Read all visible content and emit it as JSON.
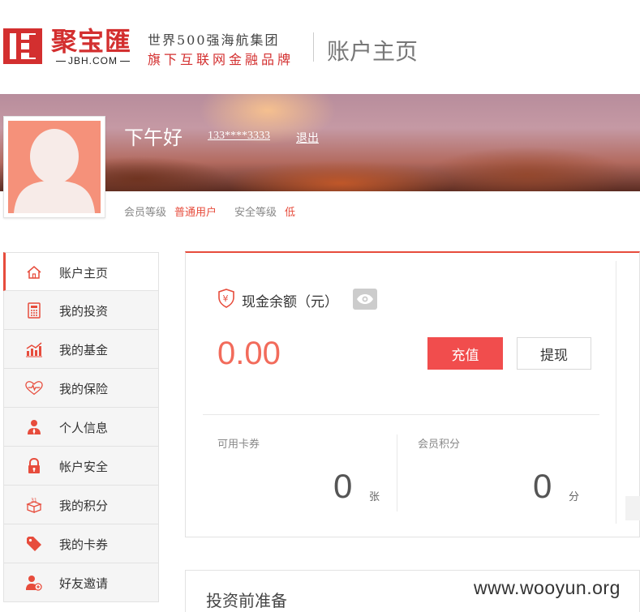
{
  "header": {
    "logo_cn": "聚宝匯",
    "logo_domain": "JBH.COM",
    "slogan_line1": "世界500强海航集团",
    "slogan_line2": "旗下互联网金融品牌",
    "page_title": "账户主页"
  },
  "profile": {
    "greeting": "下午好",
    "phone": "133****3333",
    "logout": "退出",
    "member_level_label": "会员等级",
    "member_level_value": "普通用户",
    "security_level_label": "安全等级",
    "security_level_value": "低"
  },
  "sidebar": {
    "items": [
      {
        "label": "账户主页",
        "icon": "home-icon",
        "active": true
      },
      {
        "label": "我的投资",
        "icon": "calculator-icon"
      },
      {
        "label": "我的基金",
        "icon": "chart-icon"
      },
      {
        "label": "我的保险",
        "icon": "heart-pulse-icon"
      },
      {
        "label": "个人信息",
        "icon": "user-icon"
      },
      {
        "label": "帐户安全",
        "icon": "lock-icon"
      },
      {
        "label": "我的积分",
        "icon": "gift-box-icon"
      },
      {
        "label": "我的卡券",
        "icon": "tag-icon"
      },
      {
        "label": "好友邀请",
        "icon": "invite-user-icon"
      }
    ]
  },
  "balance": {
    "title": "现金余额（元）",
    "value": "0.00",
    "recharge_label": "充值",
    "withdraw_label": "提现"
  },
  "stats": {
    "coupons_label": "可用卡券",
    "coupons_value": "0",
    "coupons_unit": "张",
    "points_label": "会员积分",
    "points_value": "0",
    "points_unit": "分"
  },
  "section2": {
    "title": "投资前准备"
  },
  "watermark": "www.wooyun.org",
  "colors": {
    "accent": "#e74c3c",
    "button_red": "#f14d4d",
    "balance": "#f26b5b",
    "avatar_bg": "#f5917a"
  }
}
